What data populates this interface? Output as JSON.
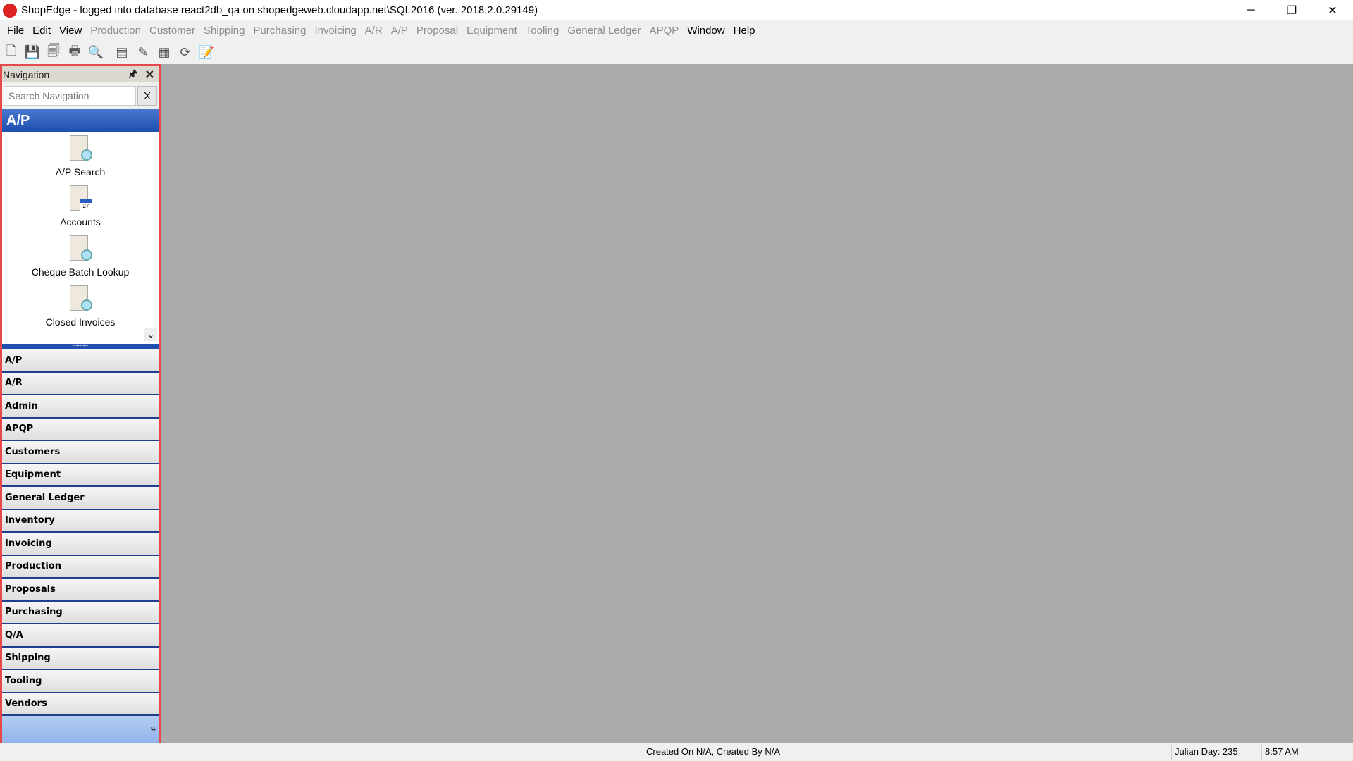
{
  "window": {
    "title": "ShopEdge -  logged into database react2db_qa on shopedgeweb.cloudapp.net\\SQL2016 (ver. 2018.2.0.29149)",
    "minimize": "─",
    "restore": "❐",
    "close": "✕"
  },
  "menu": [
    {
      "label": "File",
      "enabled": true
    },
    {
      "label": "Edit",
      "enabled": true
    },
    {
      "label": "View",
      "enabled": true
    },
    {
      "label": "Production",
      "enabled": false
    },
    {
      "label": "Customer",
      "enabled": false
    },
    {
      "label": "Shipping",
      "enabled": false
    },
    {
      "label": "Purchasing",
      "enabled": false
    },
    {
      "label": "Invoicing",
      "enabled": false
    },
    {
      "label": "A/R",
      "enabled": false
    },
    {
      "label": "A/P",
      "enabled": false
    },
    {
      "label": "Proposal",
      "enabled": false
    },
    {
      "label": "Equipment",
      "enabled": false
    },
    {
      "label": "Tooling",
      "enabled": false
    },
    {
      "label": "General Ledger",
      "enabled": false
    },
    {
      "label": "APQP",
      "enabled": false
    },
    {
      "label": "Window",
      "enabled": true
    },
    {
      "label": "Help",
      "enabled": true
    }
  ],
  "toolbar": [
    "new-icon",
    "save-icon",
    "save-all-icon",
    "print-icon",
    "print-preview-icon",
    "add-row-icon",
    "edit-icon",
    "delete-row-icon",
    "refresh-icon",
    "notes-icon"
  ],
  "navigation": {
    "title": "Navigation",
    "pin": "🖈",
    "close": "✕",
    "search_placeholder": "Search Navigation",
    "clear": "X",
    "active_group": "A/P",
    "items": [
      {
        "label": "A/P Search",
        "icon": "search"
      },
      {
        "label": "Accounts",
        "icon": "calendar"
      },
      {
        "label": "Cheque Batch Lookup",
        "icon": "search"
      },
      {
        "label": "Closed Invoices",
        "icon": "search"
      }
    ],
    "groups": [
      "A/P",
      "A/R",
      "Admin",
      "APQP",
      "Customers",
      "Equipment",
      "General Ledger",
      "Inventory",
      "Invoicing",
      "Production",
      "Proposals",
      "Purchasing",
      "Q/A",
      "Shipping",
      "Tooling",
      "Vendors"
    ],
    "more": "»"
  },
  "status": {
    "created": "Created On N/A, Created By N/A",
    "julian": "Julian Day: 235",
    "time": "8:57 AM"
  },
  "colors": {
    "accent": "#1d4fb0",
    "highlight": "#e8484a",
    "workspace": "#ababab"
  }
}
